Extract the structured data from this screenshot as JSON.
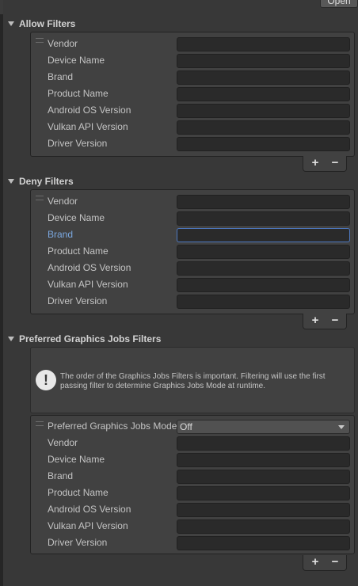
{
  "top": {
    "open_label": "Open"
  },
  "allow": {
    "title": "Allow Filters",
    "fields": [
      "Vendor",
      "Device Name",
      "Brand",
      "Product Name",
      "Android OS Version",
      "Vulkan API Version",
      "Driver Version"
    ]
  },
  "deny": {
    "title": "Deny Filters",
    "fields": [
      "Vendor",
      "Device Name",
      "Brand",
      "Product Name",
      "Android OS Version",
      "Vulkan API Version",
      "Driver Version"
    ],
    "focused_field": "Brand"
  },
  "preferred": {
    "title": "Preferred Graphics Jobs Filters",
    "info": "The order of the Graphics Jobs Filters is important. Filtering will use the first passing filter to determine Graphics Jobs Mode at runtime.",
    "mode_label": "Preferred Graphics Jobs Mode",
    "mode_value": "Off",
    "fields": [
      "Vendor",
      "Device Name",
      "Brand",
      "Product Name",
      "Android OS Version",
      "Vulkan API Version",
      "Driver Version"
    ]
  },
  "buttons": {
    "add": "+",
    "remove": "−"
  },
  "colors": {
    "background": "#383838",
    "panel": "#414141",
    "field": "#2a2a2a",
    "focus": "#4d78c0",
    "focused_label": "#7ba8e0"
  }
}
